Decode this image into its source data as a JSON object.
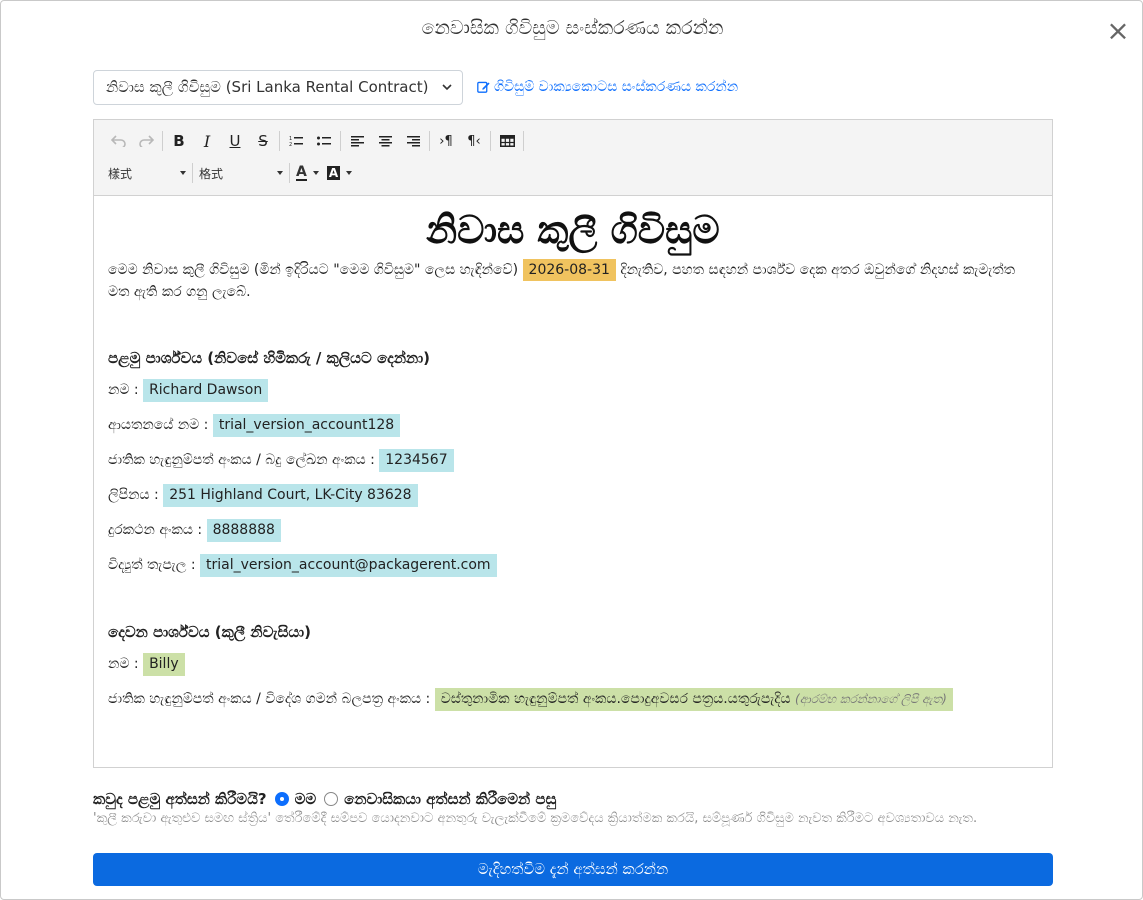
{
  "modal": {
    "title": "නෙවාසික ගිවිසුම සංස්කරණය කරන්න",
    "close_label": "×"
  },
  "template": {
    "selected": "නිවාස කුලී ගිවිසුම (Sri Lanka Rental Contract)",
    "edit_clauses_link": "ගිවිසුම් වාක්‍යකොටස සංස්කරණය කරන්න"
  },
  "toolbar": {
    "style_combo": "樣式",
    "format_combo": "格式",
    "icons": [
      "undo-icon",
      "redo-icon",
      "bold-icon",
      "italic-icon",
      "underline-icon",
      "strikethrough-icon",
      "numbered-list-icon",
      "bulleted-list-icon",
      "align-left-icon",
      "align-center-icon",
      "align-right-icon",
      "ltr-icon",
      "rtl-icon",
      "table-icon",
      "text-color-icon",
      "background-color-icon"
    ]
  },
  "document": {
    "title": "නිවාස කුලී ගිවිසුම",
    "intro_before": "මෙම නිවාස කුලී ගිවිසුම (මින් ඉදිරියට \"මෙම ගිවිසුම\" ලෙස හැඳින්වේ)",
    "date": "2026-08-31",
    "intro_after": "දිනැතිව, පහත සඳහන් පාර්ශ්ව දෙක අතර ඔවුන්ගේ නිදහස් කැමැත්ත මත ඇති කර ගනු ලැබේ.",
    "party1": {
      "heading": "පළමු පාර්ශ්වය (නිවසේ හිමිකරු / කුලියට දෙන්නා)",
      "fields": [
        {
          "label": "නම :",
          "value": "Richard Dawson"
        },
        {
          "label": "ආයතනයේ නම :",
          "value": "trial_version_account128"
        },
        {
          "label": "ජාතික හැඳුනුම්පත් අංකය / බදු ලේඛන අංකය :",
          "value": "1234567"
        },
        {
          "label": "ලිපිනය :",
          "value": "251 Highland Court, LK-City 83628"
        },
        {
          "label": "දුරකථන අංකය :",
          "value": "8888888"
        },
        {
          "label": "විද්‍යුත් තැපැල :",
          "value": "trial_version_account@packagerent.com"
        }
      ]
    },
    "party2": {
      "heading": "දෙවන පාර්ශ්වය (කුලී නිවැසියා)",
      "name_label": "නම :",
      "name_value": "Billy",
      "id_label": "ජාතික හැඳුනුම්පත් අංකය / විදේශ ගමන් බලපත්‍ර අංකය :",
      "id_value": "වස්තුනාමික හැඳුනුම්පත් අංකය.පොදුඅවසර පත්‍රය.යතුරුපැදිය",
      "id_note": "(ආරම්භ කරන්නාගේ ලිපි ඇත)"
    }
  },
  "confirm": {
    "question": "කවුද පළමු අත්සන් කිරීමයි?",
    "option_me": "මම",
    "option_tenant": "නෙවාසිකයා අත්සන් කිරීමෙන් පසු",
    "selected": "මම",
    "hint": "'කුලී කරුවා ඇතුළුව සමඟ ස්ත්‍රිය' තේරීමේදී සම්පව යොදනවාට අනතුරු වැලැක්වීමේ ක්‍රමවේදය ක්‍රියාත්මක කරයි, සම්පූර්ණ ගිවිසුම නැවත කිරීමට අවශ්‍යතාවය නැත."
  },
  "submit_label": "මැදිහත්වීම දැන් අත්සන් කරන්න"
}
